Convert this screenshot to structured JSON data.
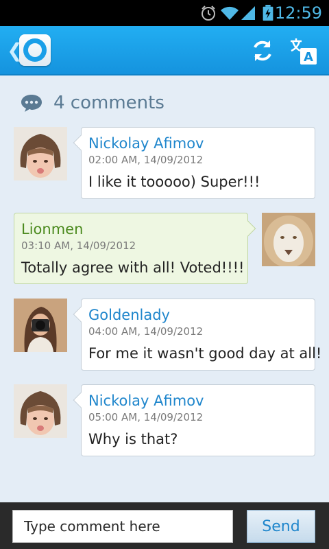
{
  "status_bar": {
    "time": "12:59",
    "icons": [
      "alarm-icon",
      "wifi-icon",
      "signal-icon",
      "battery-icon"
    ]
  },
  "action_bar": {
    "icons": [
      "back-chevron-icon",
      "app-logo-icon",
      "refresh-icon",
      "translate-icon"
    ],
    "accent_color": "#1a9fe8"
  },
  "comments": {
    "count_label": "4 comments",
    "items": [
      {
        "author": "Nickolay Afimov",
        "timestamp": "02:00 AM, 14/09/2012",
        "text": "I like it  tooooo) Super!!!",
        "own": false
      },
      {
        "author": "Lionmen",
        "timestamp": "03:10 AM, 14/09/2012",
        "text": "Totally agree with all! Voted!!!!",
        "own": true
      },
      {
        "author": "Goldenlady",
        "timestamp": "04:00 AM, 14/09/2012",
        "text": "For me it wasn't good day at all!",
        "own": false
      },
      {
        "author": "Nickolay Afimov",
        "timestamp": "05:00 AM, 14/09/2012",
        "text": "Why is that?",
        "own": false
      }
    ]
  },
  "composer": {
    "placeholder": "Type comment here",
    "value": "",
    "send_label": "Send"
  },
  "colors": {
    "author_other": "#1f86cc",
    "author_own": "#4b8a1e",
    "own_bubble": "#eef7e2",
    "background": "#e4edf6"
  }
}
